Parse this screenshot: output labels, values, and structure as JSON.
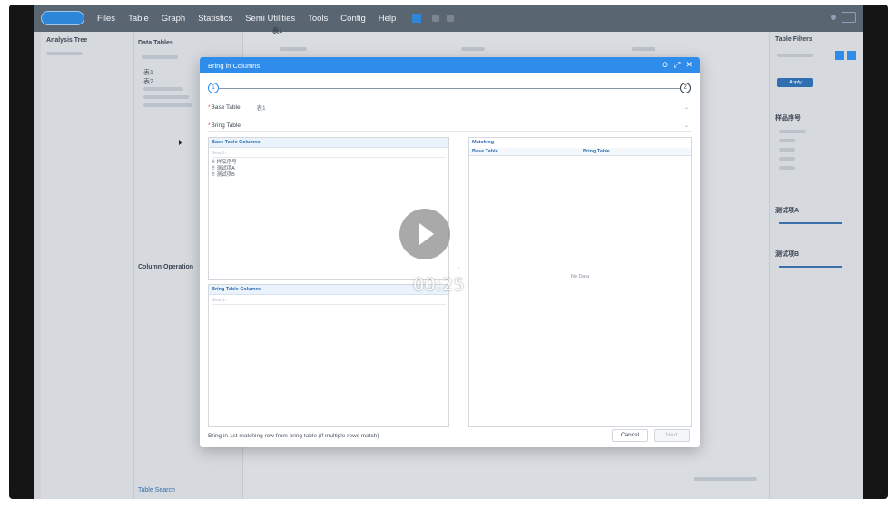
{
  "menubar": {
    "items": [
      "Files",
      "Table",
      "Graph",
      "Statistics",
      "Semi Utilities",
      "Tools",
      "Config",
      "Help"
    ]
  },
  "left_panel": {
    "title": "Analysis Tree"
  },
  "mid_panel": {
    "title": "Data Tables",
    "tables": [
      "表1",
      "表2"
    ],
    "column_operation": "Column Operation",
    "table_search": "Table Search"
  },
  "main_tab": {
    "label": "表1"
  },
  "right_panel": {
    "title": "Table Filters",
    "apply": "Apply",
    "filter1": "样品序号",
    "filter2": "测试项A",
    "filter3": "测试项B"
  },
  "modal": {
    "title": "Bring in Columns",
    "step1": "1",
    "step2": "2",
    "base_table_label": "Base Table",
    "base_table_value": "表1",
    "bring_table_label": "Bring Table",
    "base_table_columns_title": "Base Table Columns",
    "search_placeholder": "Search",
    "base_columns": [
      "样品序号",
      "测试项A",
      "测试项B"
    ],
    "matching_title": "Matching",
    "matching_headers": [
      "Base Table",
      "Bring Table"
    ],
    "bring_table_columns_title": "Bring Table Columns",
    "no_data": "No Data",
    "footer_note": "Bring in 1st matching row from bring table (if multiple rows match)",
    "cancel_label": "Cancel",
    "next_label": "Next"
  },
  "video": {
    "time": "00:25"
  },
  "colors": {
    "accent": "#2f8ceb",
    "menubar": "#5a6572"
  }
}
